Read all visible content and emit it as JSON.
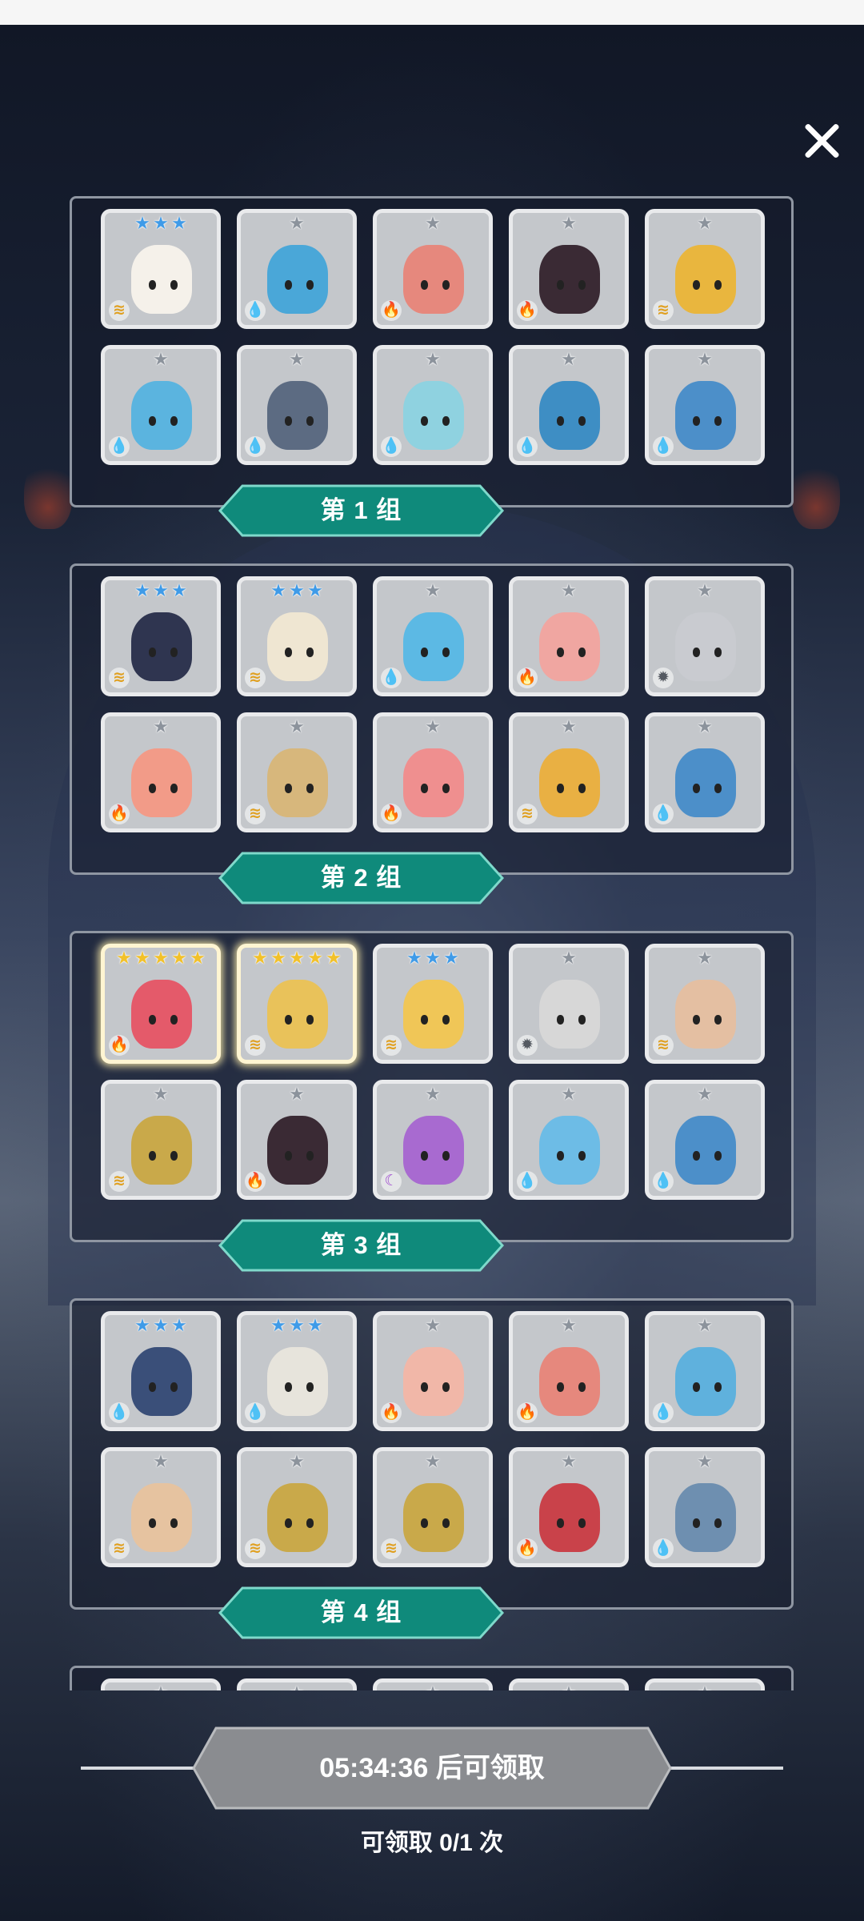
{
  "groups": [
    {
      "label": "第 1 组",
      "heroes": [
        {
          "stars": 3,
          "star_color": "blue",
          "element": "wind",
          "portrait": "#f5f1ea"
        },
        {
          "stars": 1,
          "star_color": "grey",
          "element": "water",
          "portrait": "#4aa7d8"
        },
        {
          "stars": 1,
          "star_color": "grey",
          "element": "fire",
          "portrait": "#e6887d"
        },
        {
          "stars": 1,
          "star_color": "grey",
          "element": "fire",
          "portrait": "#3a2a34"
        },
        {
          "stars": 1,
          "star_color": "grey",
          "element": "wind",
          "portrait": "#e9b63e"
        },
        {
          "stars": 1,
          "star_color": "grey",
          "element": "water",
          "portrait": "#5bb4df"
        },
        {
          "stars": 1,
          "star_color": "grey",
          "element": "water",
          "portrait": "#5c6b82"
        },
        {
          "stars": 1,
          "star_color": "grey",
          "element": "water",
          "portrait": "#8fd2e0"
        },
        {
          "stars": 1,
          "star_color": "grey",
          "element": "water",
          "portrait": "#3e8ec4"
        },
        {
          "stars": 1,
          "star_color": "grey",
          "element": "water",
          "portrait": "#4c8fc9"
        }
      ]
    },
    {
      "label": "第 2 组",
      "heroes": [
        {
          "stars": 3,
          "star_color": "blue",
          "element": "wind",
          "portrait": "#2f3550"
        },
        {
          "stars": 3,
          "star_color": "blue",
          "element": "wind",
          "portrait": "#efe6d2"
        },
        {
          "stars": 1,
          "star_color": "grey",
          "element": "water",
          "portrait": "#5cb9e4"
        },
        {
          "stars": 1,
          "star_color": "grey",
          "element": "fire",
          "portrait": "#f0a6a1"
        },
        {
          "stars": 1,
          "star_color": "grey",
          "element": "light",
          "portrait": "#c9cbd0"
        },
        {
          "stars": 1,
          "star_color": "grey",
          "element": "fire",
          "portrait": "#f29b88"
        },
        {
          "stars": 1,
          "star_color": "grey",
          "element": "wind",
          "portrait": "#d7b77c"
        },
        {
          "stars": 1,
          "star_color": "grey",
          "element": "fire",
          "portrait": "#ef8f8f"
        },
        {
          "stars": 1,
          "star_color": "grey",
          "element": "wind",
          "portrait": "#e9b043"
        },
        {
          "stars": 1,
          "star_color": "grey",
          "element": "water",
          "portrait": "#4c8fc9"
        }
      ]
    },
    {
      "label": "第 3 组",
      "heroes": [
        {
          "stars": 5,
          "star_color": "gold",
          "element": "fire",
          "portrait": "#e45a6a",
          "highlight": true
        },
        {
          "stars": 5,
          "star_color": "gold",
          "element": "wind",
          "portrait": "#e9c25a",
          "highlight": true
        },
        {
          "stars": 3,
          "star_color": "blue",
          "element": "wind",
          "portrait": "#f0c657"
        },
        {
          "stars": 1,
          "star_color": "grey",
          "element": "light",
          "portrait": "#d7d7d7"
        },
        {
          "stars": 1,
          "star_color": "grey",
          "element": "wind",
          "portrait": "#e4bfa2"
        },
        {
          "stars": 1,
          "star_color": "grey",
          "element": "wind",
          "portrait": "#c9a94a"
        },
        {
          "stars": 1,
          "star_color": "grey",
          "element": "fire",
          "portrait": "#3a2a34"
        },
        {
          "stars": 1,
          "star_color": "grey",
          "element": "dark",
          "portrait": "#a86ad0"
        },
        {
          "stars": 1,
          "star_color": "grey",
          "element": "water",
          "portrait": "#6dbce6"
        },
        {
          "stars": 1,
          "star_color": "grey",
          "element": "water",
          "portrait": "#4c8fc9"
        }
      ]
    },
    {
      "label": "第 4 组",
      "heroes": [
        {
          "stars": 3,
          "star_color": "blue",
          "element": "water",
          "portrait": "#3a4f79"
        },
        {
          "stars": 3,
          "star_color": "blue",
          "element": "water",
          "portrait": "#e7e4dc"
        },
        {
          "stars": 1,
          "star_color": "grey",
          "element": "fire",
          "portrait": "#f1b7a8"
        },
        {
          "stars": 1,
          "star_color": "grey",
          "element": "fire",
          "portrait": "#e6887d"
        },
        {
          "stars": 1,
          "star_color": "grey",
          "element": "water",
          "portrait": "#5fb1dd"
        },
        {
          "stars": 1,
          "star_color": "grey",
          "element": "wind",
          "portrait": "#e6c3a0"
        },
        {
          "stars": 1,
          "star_color": "grey",
          "element": "wind",
          "portrait": "#c9a94a"
        },
        {
          "stars": 1,
          "star_color": "grey",
          "element": "wind",
          "portrait": "#c9a94a"
        },
        {
          "stars": 1,
          "star_color": "grey",
          "element": "fire",
          "portrait": "#c9424a"
        },
        {
          "stars": 1,
          "star_color": "grey",
          "element": "water",
          "portrait": "#6e8fb0"
        }
      ]
    },
    {
      "label": "",
      "partial": true,
      "heroes": [
        {
          "stars": 1,
          "star_color": "grey",
          "element": "",
          "portrait": "#c4c7cb"
        },
        {
          "stars": 1,
          "star_color": "grey",
          "element": "",
          "portrait": "#c4c7cb"
        },
        {
          "stars": 1,
          "star_color": "grey",
          "element": "",
          "portrait": "#c4c7cb"
        },
        {
          "stars": 1,
          "star_color": "grey",
          "element": "",
          "portrait": "#c4c7cb"
        },
        {
          "stars": 1,
          "star_color": "grey",
          "element": "",
          "portrait": "#c4c7cb"
        }
      ]
    }
  ],
  "element_icons": {
    "water": {
      "glyph": "💧",
      "color": "#2e86de"
    },
    "fire": {
      "glyph": "🔥",
      "color": "#e2452f"
    },
    "wind": {
      "glyph": "≋",
      "color": "#e0a020"
    },
    "light": {
      "glyph": "✹",
      "color": "#555a62"
    },
    "dark": {
      "glyph": "☾",
      "color": "#a04ad0"
    }
  },
  "footer": {
    "claim_button_label": "05:34:36 后可领取",
    "claim_count_text": "可领取 0/1 次"
  },
  "colors": {
    "label_fill": "#0f8a7b",
    "label_border": "#7fd9cb",
    "button_fill": "#8a8c90"
  }
}
